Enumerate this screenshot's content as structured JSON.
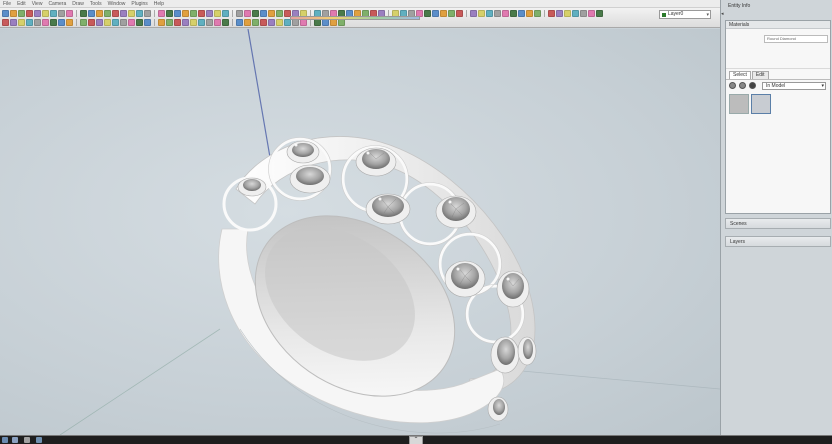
{
  "window": {
    "menus": [
      "File",
      "Edit",
      "View",
      "Camera",
      "Draw",
      "Tools",
      "Window",
      "Plugins",
      "Help"
    ]
  },
  "toolbar": {
    "layer_name": "Layer0"
  },
  "tray": {
    "title": "Entity Info",
    "materials": {
      "header": "Materials",
      "name_field": "Round Diamond",
      "tab_select": "Select",
      "tab_edit": "Edit",
      "collection": "In Model"
    },
    "section_scenes": "Scenes",
    "section_layers": "Layers"
  },
  "colors": {
    "viewport_bg": "#c9d2d8",
    "ring_metal": "#f4f4f4",
    "gem": "#8c8c8c",
    "axis_blue": "#3a4fa0"
  }
}
